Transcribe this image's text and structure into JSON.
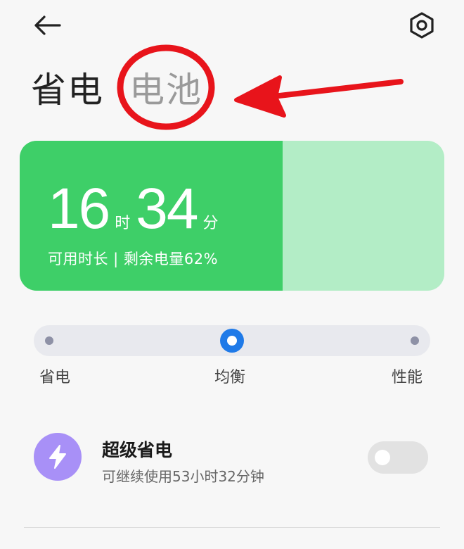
{
  "header": {
    "back_icon": "arrow-left-icon",
    "settings_icon": "settings-hexagon-icon"
  },
  "title": {
    "main": "省电",
    "tab": "电池"
  },
  "battery": {
    "hours": "16",
    "hours_unit": "时",
    "minutes": "34",
    "minutes_unit": "分",
    "subtitle": "可用时长 | 剩余电量62%",
    "level": 0.62,
    "fill_color": "#3ecf68",
    "empty_color": "#b3edc6"
  },
  "mode": {
    "options": [
      "省电",
      "均衡",
      "性能"
    ],
    "selected_index": 1,
    "accent": "#1f7ae8"
  },
  "super_power_saving": {
    "icon": "lightning-bolt-icon",
    "icon_color": "#a890f7",
    "title": "超级省电",
    "subtitle": "可继续使用53小时32分钟",
    "enabled": false
  },
  "annotation": {
    "color": "#e8141b"
  }
}
